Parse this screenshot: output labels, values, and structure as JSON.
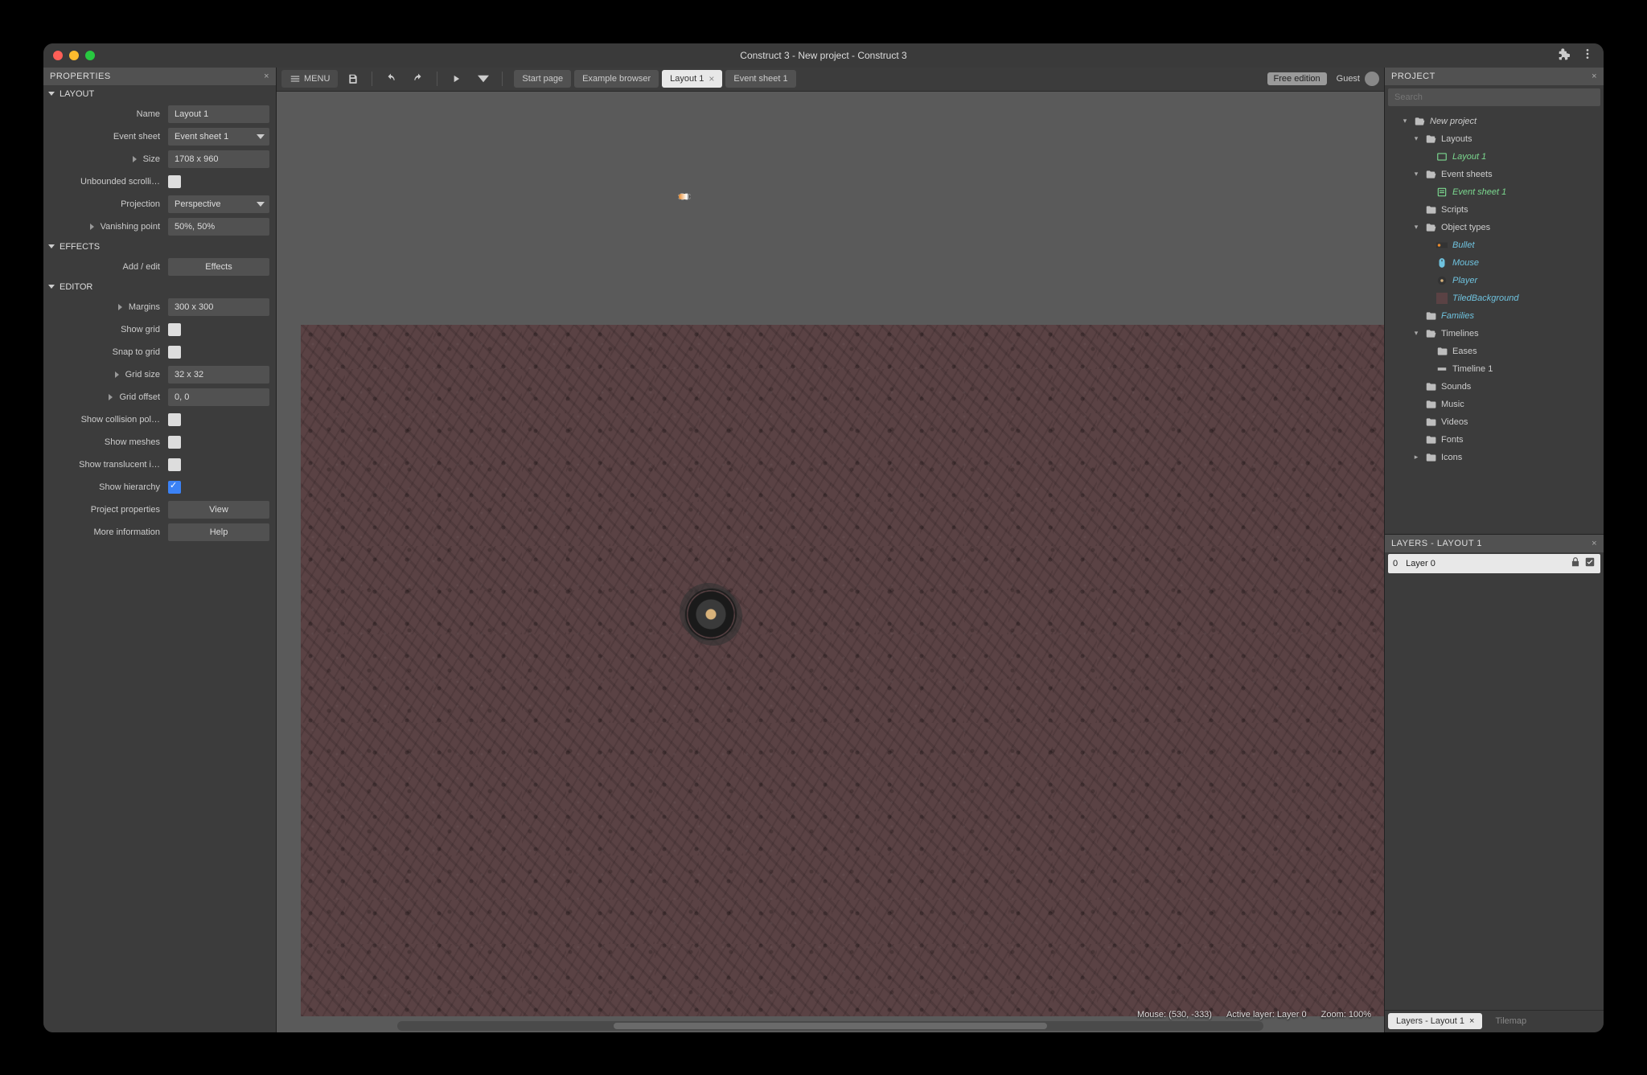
{
  "titlebar": {
    "title": "Construct 3 - New project - Construct 3"
  },
  "toolbar": {
    "menu_label": "MENU",
    "free_edition": "Free edition",
    "guest": "Guest"
  },
  "tabs": [
    {
      "label": "Start page"
    },
    {
      "label": "Example browser"
    },
    {
      "label": "Layout 1",
      "active": true,
      "closable": true
    },
    {
      "label": "Event sheet 1"
    }
  ],
  "properties": {
    "panel_title": "PROPERTIES",
    "sections": {
      "layout": {
        "title": "LAYOUT",
        "name": {
          "label": "Name",
          "value": "Layout 1"
        },
        "event_sheet": {
          "label": "Event sheet",
          "value": "Event sheet 1"
        },
        "size": {
          "label": "Size",
          "value": "1708 x 960"
        },
        "unbounded": {
          "label": "Unbounded scrolli…",
          "checked": false
        },
        "projection": {
          "label": "Projection",
          "value": "Perspective"
        },
        "vanishing": {
          "label": "Vanishing point",
          "value": "50%, 50%"
        }
      },
      "effects": {
        "title": "EFFECTS",
        "add_edit": {
          "label": "Add / edit",
          "button": "Effects"
        }
      },
      "editor": {
        "title": "EDITOR",
        "margins": {
          "label": "Margins",
          "value": "300 x 300"
        },
        "show_grid": {
          "label": "Show grid",
          "checked": false
        },
        "snap_grid": {
          "label": "Snap to grid",
          "checked": false
        },
        "grid_size": {
          "label": "Grid size",
          "value": "32 x 32"
        },
        "grid_offset": {
          "label": "Grid offset",
          "value": "0, 0"
        },
        "show_coll": {
          "label": "Show collision pol…",
          "checked": false
        },
        "show_meshes": {
          "label": "Show meshes",
          "checked": false
        },
        "show_trans": {
          "label": "Show translucent i…",
          "checked": false
        },
        "show_hier": {
          "label": "Show hierarchy",
          "checked": true
        },
        "project_props": {
          "label": "Project properties",
          "button": "View"
        },
        "more_info": {
          "label": "More information",
          "button": "Help"
        }
      }
    }
  },
  "canvas": {
    "status": {
      "mouse": "Mouse: (530, -333)",
      "active_layer": "Active layer: Layer 0",
      "zoom": "Zoom: 100%"
    }
  },
  "project_panel": {
    "title": "PROJECT",
    "search_placeholder": "Search",
    "tree": {
      "root": "New project",
      "layouts": {
        "label": "Layouts",
        "items": [
          "Layout 1"
        ]
      },
      "event_sheets": {
        "label": "Event sheets",
        "items": [
          "Event sheet 1"
        ]
      },
      "scripts": "Scripts",
      "object_types": {
        "label": "Object types",
        "items": [
          "Bullet",
          "Mouse",
          "Player",
          "TiledBackground"
        ]
      },
      "families": "Families",
      "timelines": {
        "label": "Timelines",
        "eases": "Eases",
        "items": [
          "Timeline 1"
        ]
      },
      "sounds": "Sounds",
      "music": "Music",
      "videos": "Videos",
      "fonts": "Fonts",
      "icons": "Icons"
    }
  },
  "layers_panel": {
    "title": "LAYERS - LAYOUT 1",
    "layers": [
      {
        "index": "0",
        "name": "Layer 0"
      }
    ],
    "bottom_tabs": {
      "active": "Layers - Layout 1",
      "inactive": "Tilemap"
    }
  }
}
